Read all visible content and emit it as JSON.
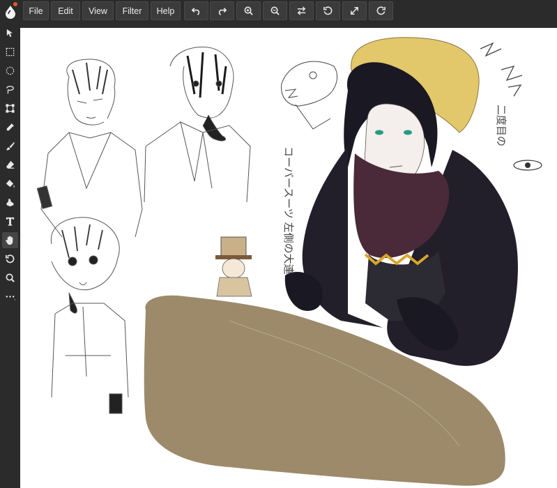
{
  "menu": {
    "file": "File",
    "edit": "Edit",
    "view": "View",
    "filter": "Filter",
    "help": "Help"
  },
  "toolbar_actions": [
    "undo-icon",
    "redo-icon",
    "zoom-in-icon",
    "zoom-out-icon",
    "swap-icon",
    "rotate-left-icon",
    "fullscreen-icon",
    "rotate-right-icon"
  ],
  "tools": [
    "move-icon",
    "rect-select-icon",
    "ellipse-select-icon",
    "lasso-icon",
    "transform-icon",
    "eyedropper-icon",
    "brush-icon",
    "eraser-icon",
    "fill-icon",
    "smudge-icon",
    "text-icon",
    "hand-icon",
    "rotate-icon",
    "magnify-icon",
    "more-icon"
  ],
  "active_tool": "hand-icon",
  "canvas": {
    "handwritten_text": "コーバースーツ 左側の大連",
    "handwritten_text_2": "二度目の"
  },
  "colors": {
    "ui_bg": "#2b2b2b",
    "button_bg": "#3b3b3b",
    "icon": "#e8e8e8",
    "canvas": "#ffffff",
    "brown_stroke": "#9c8a6a",
    "coat": "#231f2a",
    "scarf": "#4a2a38",
    "hair_blonde": "#e2c86a",
    "hair_dark": "#1a1822",
    "logo_dot": "#e8572a"
  }
}
